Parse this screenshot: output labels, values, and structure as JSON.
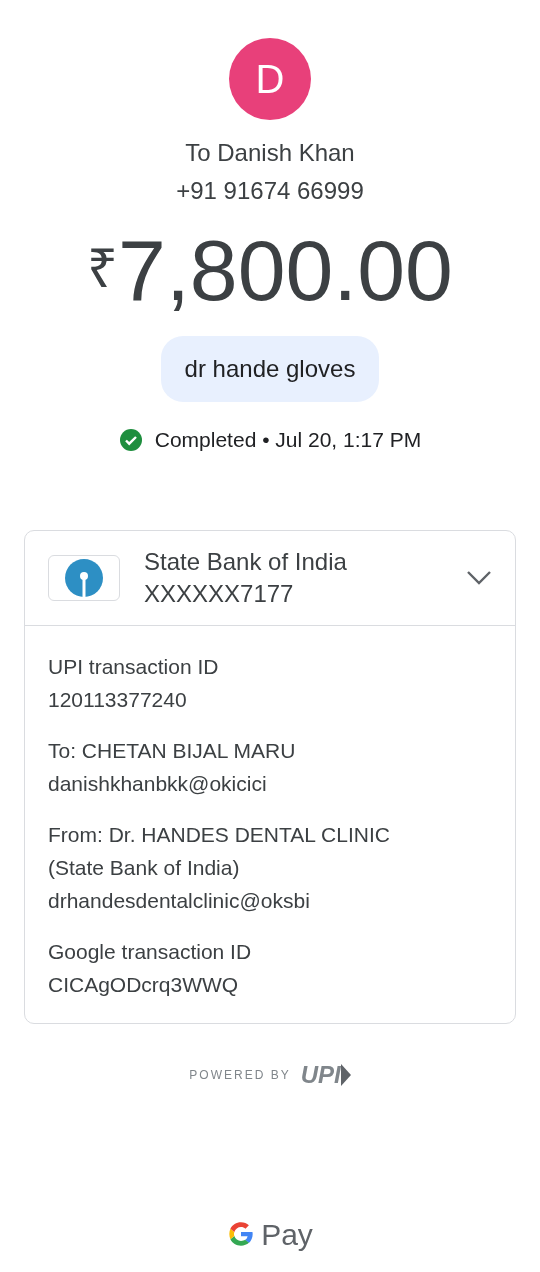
{
  "recipient": {
    "initial": "D",
    "name": "To Danish Khan",
    "phone": "+91 91674 66999"
  },
  "amount": {
    "currency": "₹",
    "value": "7,800.00"
  },
  "note": "dr hande gloves",
  "status": {
    "kind": "completed",
    "text": "Completed • Jul 20, 1:17 PM"
  },
  "account": {
    "bank": "State Bank of India",
    "number": "XXXXXX7177"
  },
  "details": [
    {
      "lines": [
        "UPI transaction ID",
        "120113377240"
      ]
    },
    {
      "lines": [
        "To: CHETAN BIJAL MARU",
        "danishkhanbkk@okicici"
      ]
    },
    {
      "lines": [
        "From: Dr. HANDES DENTAL CLINIC",
        "(State Bank of India)",
        "drhandesdentalclinic@oksbi"
      ]
    },
    {
      "lines": [
        "Google transaction ID",
        "CICAgODcrq3WWQ"
      ]
    }
  ],
  "powered_by": {
    "label": "POWERED BY",
    "logo": "UPI"
  },
  "footer": {
    "brand": "Pay"
  }
}
